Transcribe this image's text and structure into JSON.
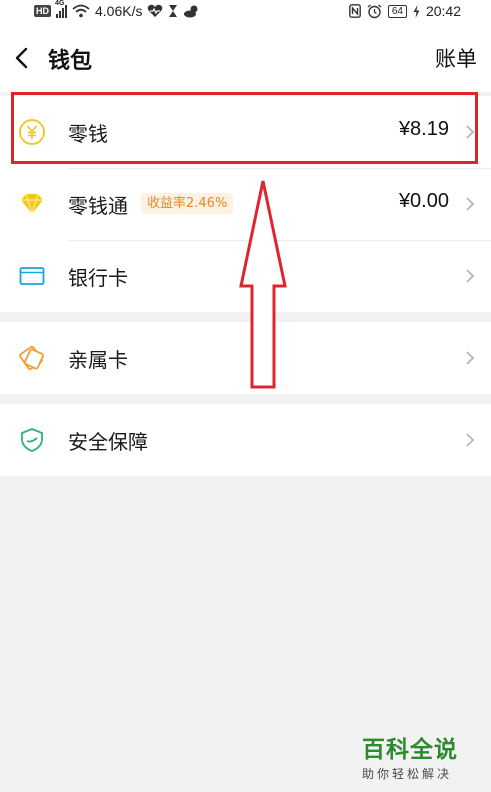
{
  "status_bar": {
    "hd": "HD",
    "network_gen": "4G",
    "speed": "4.06K/s",
    "battery": "64",
    "time": "20:42"
  },
  "header": {
    "title": "钱包",
    "bill": "账单"
  },
  "rows": [
    {
      "label": "零钱",
      "amount": "¥8.19",
      "icon": "yuan-coin-icon",
      "icon_color": "#f0c419"
    },
    {
      "label": "零钱通",
      "badge": "收益率2.46%",
      "amount": "¥0.00",
      "icon": "diamond-icon",
      "icon_color": "#f5c518"
    },
    {
      "label": "银行卡",
      "icon": "bank-card-icon",
      "icon_color": "#1aa3e0"
    },
    {
      "label": "亲属卡",
      "icon": "family-card-icon",
      "icon_color": "#f0a030"
    },
    {
      "label": "安全保障",
      "icon": "shield-icon",
      "icon_color": "#2db36f"
    }
  ],
  "annotation_color": "#e0242b",
  "watermark": {
    "title": "百科全说",
    "subtitle": "助你轻松解决"
  }
}
